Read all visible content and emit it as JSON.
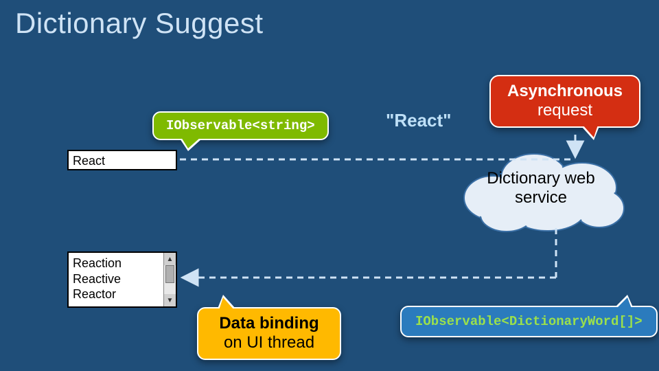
{
  "title": "Dictionary Suggest",
  "observable_string_label": "IObservable<string>",
  "react_quoted": "\"React\"",
  "async_request": {
    "line1": "Asynchronous",
    "line2": "request"
  },
  "input_value": "React",
  "cloud_label": "Dictionary web service",
  "results": [
    "Reaction",
    "Reactive",
    "Reactor"
  ],
  "data_binding": {
    "line1": "Data binding",
    "line2": "on UI thread"
  },
  "observable_result_label": "IObservable<DictionaryWord[]>",
  "colors": {
    "bg": "#1f4e79",
    "green": "#7fba00",
    "red": "#d42e12",
    "orange": "#ffb900",
    "blue": "#2b7bbd",
    "accent_text": "#9be04c"
  }
}
